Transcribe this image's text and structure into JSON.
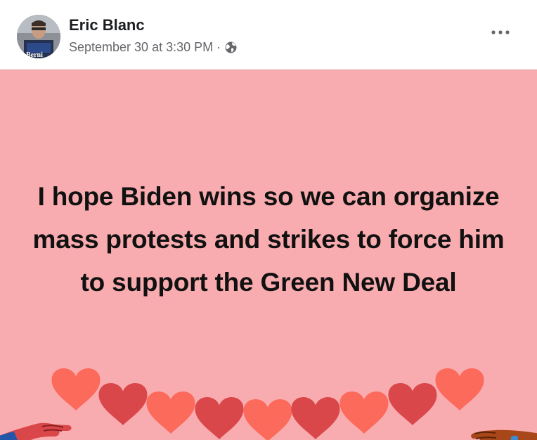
{
  "post": {
    "author": "Eric Blanc",
    "date": "September 30 at 3:30 PM",
    "separator": "·",
    "privacy_icon": "globe-icon",
    "more_icon": "more-options-icon",
    "avatar_book_text": "Berni"
  },
  "content": {
    "text": "I hope Biden wins so we can organize mass protests and strikes to force him to support the Green New Deal",
    "background_color": "#f9acaf",
    "decoration": "hands-holding-heart-garland"
  }
}
